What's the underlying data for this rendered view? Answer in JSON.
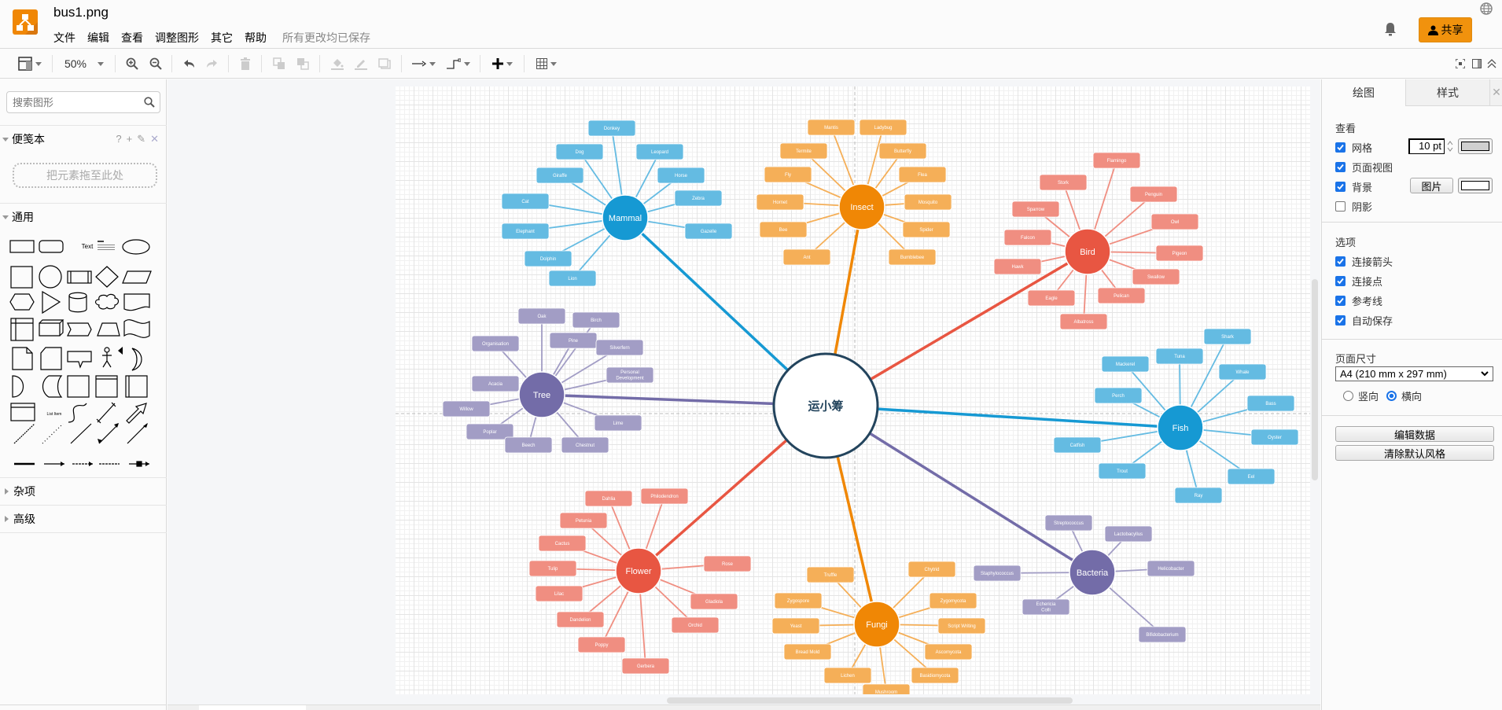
{
  "app": {
    "doc_title": "bus1.png",
    "menus": [
      "文件",
      "编辑",
      "查看",
      "调整图形",
      "其它",
      "帮助"
    ],
    "save_status": "所有更改均已保存",
    "share_label": "共享",
    "brand_color": "#f08705"
  },
  "toolbar": {
    "zoom_level": "50%"
  },
  "sidebar": {
    "search_placeholder": "搜索图形",
    "scratchpad_label": "便笺本",
    "scratchpad_tools": [
      "?",
      "+",
      "✎",
      "✕"
    ],
    "dropzone_label": "把元素拖至此处",
    "general_label": "通用",
    "misc_label": "杂项",
    "advanced_label": "高级",
    "shape_text_label": "Text",
    "shape_list_item_label": "List Item"
  },
  "right_panel": {
    "tabs": [
      "绘图",
      "样式"
    ],
    "view_heading": "查看",
    "view_options": [
      {
        "label": "网格",
        "checked": true
      },
      {
        "label": "页面视图",
        "checked": true
      },
      {
        "label": "背景",
        "checked": true
      },
      {
        "label": "阴影",
        "checked": false
      }
    ],
    "grid_size": "10 pt",
    "background_image_button": "图片",
    "options_heading": "选项",
    "options": [
      {
        "label": "连接箭头",
        "checked": true
      },
      {
        "label": "连接点",
        "checked": true
      },
      {
        "label": "参考线",
        "checked": true
      },
      {
        "label": "自动保存",
        "checked": true
      }
    ],
    "page_size_heading": "页面尺寸",
    "page_size_value": "A4 (210 mm x 297 mm)",
    "orientation": [
      {
        "label": "竖向",
        "selected": false
      },
      {
        "label": "横向",
        "selected": true
      }
    ],
    "edit_data_button": "编辑数据",
    "clear_style_button": "清除默认风格"
  },
  "diagram": {
    "root": {
      "label": "运小筹",
      "border_color": "#23445d"
    },
    "branches": [
      {
        "label": "Mammal",
        "color": "#1699d3",
        "leaf_color": "#64bbe2",
        "leaves": [
          "Donkey",
          "Dog",
          "Leopard",
          "Giraffe",
          "Horse",
          "Zebra",
          "Cat",
          "Gazelle",
          "Elephant",
          "Dolphin",
          "Lion"
        ]
      },
      {
        "label": "Insect",
        "color": "#f08705",
        "leaf_color": "#f5af58",
        "leaves": [
          "Mantis",
          "Ladybug",
          "Termite",
          "Butterfly",
          "Fly",
          "Flea",
          "Hornet",
          "Mosquito",
          "Bee",
          "Spider",
          "Ant",
          "Bumblebee"
        ]
      },
      {
        "label": "Bird",
        "color": "#e85642",
        "leaf_color": "#f08e81",
        "leaves": [
          "Flamingo",
          "Stork",
          "Penguin",
          "Sparrow",
          "Owl",
          "Falcon",
          "Pigeon",
          "Hawk",
          "Swallow",
          "Eagle",
          "Pelican",
          "Albatross"
        ]
      },
      {
        "label": "Tree",
        "color": "#736ca8",
        "leaf_color": "#a29dc5",
        "leaves": [
          "Oak",
          "Birch",
          "Organisation",
          "Pine",
          "Silverfern",
          "Personal Development",
          "Acacia",
          "Willow",
          "Lime",
          "Poplar",
          "Beech",
          "Chestnut"
        ]
      },
      {
        "label": "Fish",
        "color": "#1699d3",
        "leaf_color": "#64bbe2",
        "leaves": [
          "Shark",
          "Tuna",
          "Mackerel",
          "Whale",
          "Perch",
          "Bass",
          "Oyster",
          "Catfish",
          "Eel",
          "Trout",
          "Ray"
        ]
      },
      {
        "label": "Flower",
        "color": "#e85642",
        "leaf_color": "#f08e81",
        "leaves": [
          "Dahlia",
          "Philodendron",
          "Petunia",
          "Cactus",
          "Rose",
          "Tulip",
          "Lilac",
          "Gladiola",
          "Dandelion",
          "Orchid",
          "Poppy",
          "Gerbera"
        ]
      },
      {
        "label": "Fungi",
        "color": "#f08705",
        "leaf_color": "#f5af58",
        "leaves": [
          "Chytrid",
          "Truffle",
          "Zygospore",
          "Zygomycota",
          "Yeast",
          "Script Writing",
          "Bread Mold",
          "Ascomycota",
          "Lichen",
          "Basidiomycota",
          "Mushroom"
        ]
      },
      {
        "label": "Bacteria",
        "color": "#736ca8",
        "leaf_color": "#a29dc5",
        "leaves": [
          "Streptococcus",
          "Lactobacyllus",
          "Staphylococcus",
          "Helicobacter",
          "Echericia Colli",
          "Bifidobacterium"
        ]
      }
    ]
  }
}
